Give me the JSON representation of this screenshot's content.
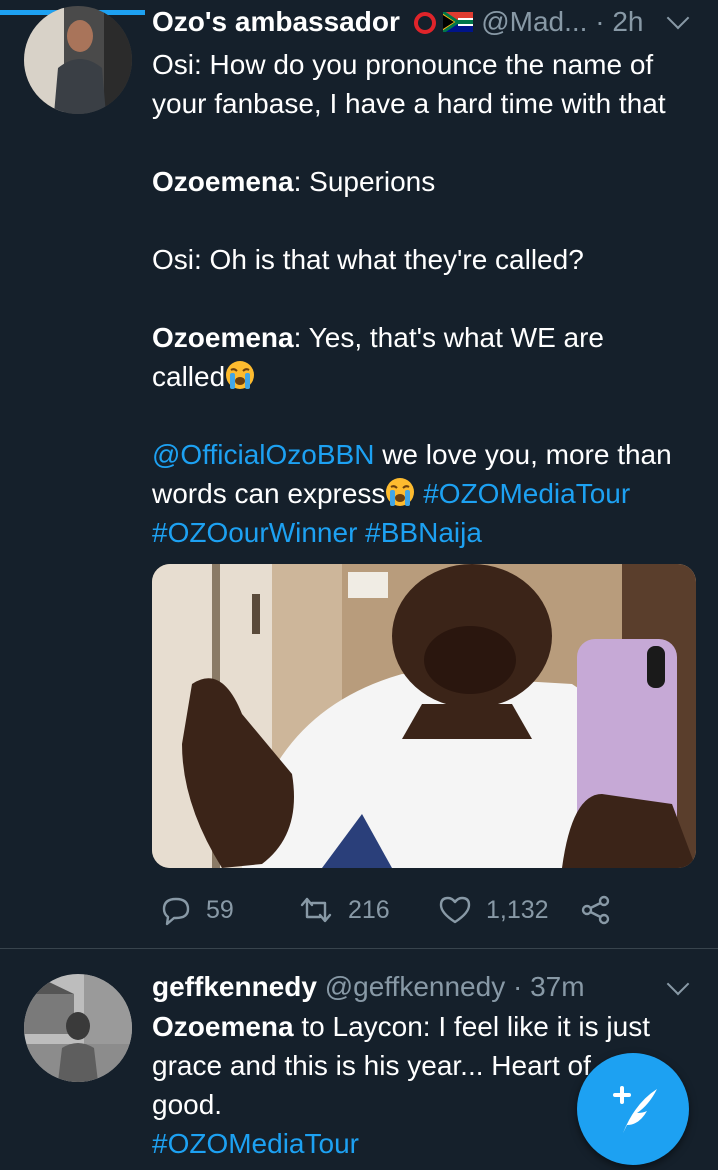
{
  "tweets": [
    {
      "name": "Ozo's ambassador",
      "handle": "@Mad...",
      "time": "· 2h",
      "body": {
        "l1": "Osi: How do you pronounce the name of",
        "l2": "your fanbase, I have a hard time with that",
        "l3_bold": "Ozoemena",
        "l3_rest": ": Superions",
        "l4": "Osi: Oh is that what they're called?",
        "l5_bold": "Ozoemena",
        "l5_rest": ": Yes, that's what WE are",
        "l6": "called",
        "l7_mention": "@OfficialOzoBBN",
        "l7_rest": " we love you, more than",
        "l8": "words can express",
        "l8_tag": " #OZOMediaTour",
        "l9_tag1": "#OZOourWinner",
        "l9_tag2": " #BBNaija"
      },
      "actions": {
        "replies": "59",
        "retweets": "216",
        "likes": "1,132"
      }
    },
    {
      "name": "geffkennedy",
      "handle": "@geffkennedy",
      "time": "· 37m",
      "body": {
        "l1_bold": "Ozoemena",
        "l1_rest": " to Laycon: I feel like it is just",
        "l2": "grace and this is his year... Heart of",
        "l3": "good.",
        "l4_tag": "#OZOMediaTour"
      }
    }
  ],
  "colors": {
    "background": "#15202b",
    "accent": "#1da1f2",
    "muted": "#8899a6",
    "divider": "#38444d"
  },
  "icons": [
    "reply-icon",
    "retweet-icon",
    "like-icon",
    "share-icon",
    "chevron-down-icon",
    "compose-icon",
    "loudly-crying-face-emoji",
    "south-africa-flag-icon"
  ]
}
